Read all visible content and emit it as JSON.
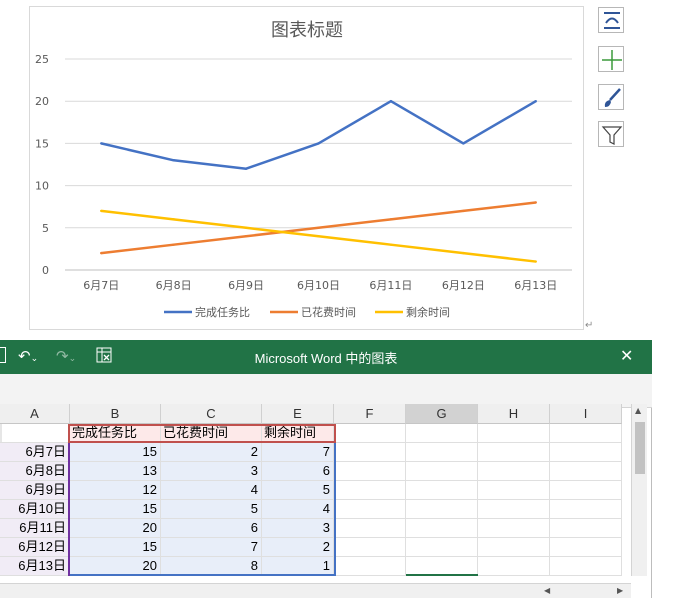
{
  "doc": {
    "paragraph_mark": "↵"
  },
  "chart_controls": [
    {
      "name": "layout-options-icon"
    },
    {
      "name": "chart-elements-icon"
    },
    {
      "name": "chart-styles-icon"
    },
    {
      "name": "chart-filters-icon"
    }
  ],
  "chart_data": {
    "type": "line",
    "title": "图表标题",
    "categories": [
      "6月7日",
      "6月8日",
      "6月9日",
      "6月10日",
      "6月11日",
      "6月12日",
      "6月13日"
    ],
    "ylim": [
      0,
      25
    ],
    "yticks": [
      0,
      5,
      10,
      15,
      20,
      25
    ],
    "grid": true,
    "legend_position": "bottom",
    "series": [
      {
        "name": "完成任务比",
        "color": "#4472c4",
        "values": [
          15,
          13,
          12,
          15,
          20,
          15,
          20
        ]
      },
      {
        "name": "已花费时间",
        "color": "#ed7d31",
        "values": [
          2,
          3,
          4,
          5,
          6,
          7,
          8
        ]
      },
      {
        "name": "剩余时间",
        "color": "#ffc000",
        "values": [
          7,
          6,
          5,
          4,
          3,
          2,
          1
        ]
      }
    ]
  },
  "excel": {
    "title": "Microsoft Word 中的图表",
    "close_label": "✕",
    "undo_icon": "↶",
    "redo_icon": "↷",
    "columns": [
      "A",
      "B",
      "C",
      "E",
      "F",
      "G",
      "H",
      "I"
    ],
    "selected_column": "G",
    "headers": [
      "完成任务比",
      "已花费时间",
      "剩余时间"
    ],
    "rows": [
      {
        "label": "6月7日",
        "values": [
          15,
          2,
          7
        ]
      },
      {
        "label": "6月8日",
        "values": [
          13,
          3,
          6
        ]
      },
      {
        "label": "6月9日",
        "values": [
          12,
          4,
          5
        ]
      },
      {
        "label": "6月10日",
        "values": [
          15,
          5,
          4
        ]
      },
      {
        "label": "6月11日",
        "values": [
          20,
          6,
          3
        ]
      },
      {
        "label": "6月12日",
        "values": [
          15,
          7,
          2
        ]
      },
      {
        "label": "6月13日",
        "values": [
          20,
          8,
          1
        ]
      }
    ]
  }
}
